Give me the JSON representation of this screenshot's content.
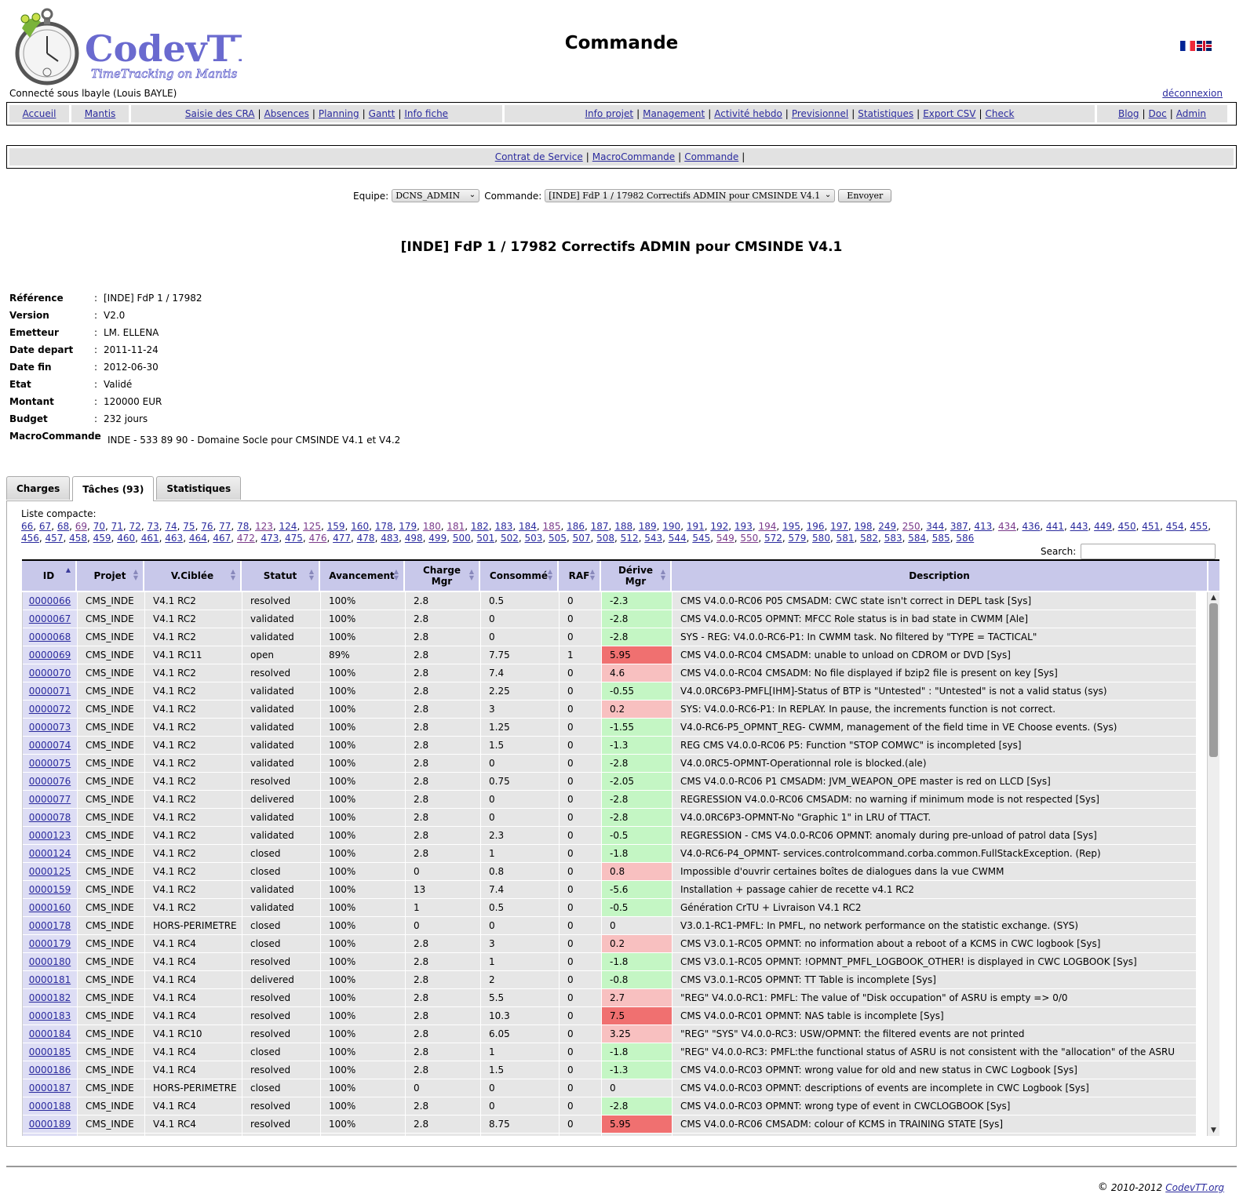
{
  "header": {
    "logo_text": "CodevTT",
    "logo_subtitle": "TimeTracking on Mantis",
    "page_title": "Commande",
    "user_line": "Connecté sous lbayle (Louis BAYLE)",
    "logout": "déconnexion"
  },
  "menu": {
    "home": "Accueil",
    "mantis": "Mantis",
    "group1": [
      "Saisie des CRA",
      "Absences",
      "Planning",
      "Gantt",
      "Info fiche"
    ],
    "group2": [
      "Info projet",
      "Management",
      "Activité hebdo",
      "Previsionnel",
      "Statistiques",
      "Export CSV",
      "Check"
    ],
    "group3": [
      "Blog",
      "Doc",
      "Admin"
    ]
  },
  "submenu": [
    "Contrat de Service",
    "MacroCommande",
    "Commande"
  ],
  "selector": {
    "team_label": "Equipe:",
    "team_value": "DCNS_ADMIN",
    "command_label": "Commande:",
    "command_value": "[INDE] FdP 1 / 17982 Correctifs ADMIN pour CMSINDE V4.1",
    "submit": "Envoyer"
  },
  "command_title": "[INDE] FdP 1 / 17982 Correctifs ADMIN pour CMSINDE V4.1",
  "info": {
    "reference_label": "Référence",
    "reference": "[INDE] FdP 1 / 17982",
    "version_label": "Version",
    "version": "V2.0",
    "emitter_label": "Emetteur",
    "emitter": "LM. ELLENA",
    "start_label": "Date depart",
    "start": "2011-11-24",
    "end_label": "Date fin",
    "end": "2012-06-30",
    "state_label": "Etat",
    "state": "Validé",
    "amount_label": "Montant",
    "amount": "120000 EUR",
    "budget_label": "Budget",
    "budget": "232 jours",
    "macro_label": "MacroCommande",
    "macro": "INDE - 533 89 90 - Domaine Socle pour CMSINDE V4.1 et V4.2"
  },
  "tabs": [
    "Charges",
    "Tâches (93)",
    "Statistiques"
  ],
  "compact": {
    "label": "Liste compacte:",
    "ids": [
      "66",
      "67",
      "68",
      "69",
      "70",
      "71",
      "72",
      "73",
      "74",
      "75",
      "76",
      "77",
      "78",
      "123",
      "124",
      "125",
      "159",
      "160",
      "178",
      "179",
      "180",
      "181",
      "182",
      "183",
      "184",
      "185",
      "186",
      "187",
      "188",
      "189",
      "190",
      "191",
      "192",
      "193",
      "194",
      "195",
      "196",
      "197",
      "198",
      "249",
      "250",
      "344",
      "387",
      "413",
      "434",
      "436",
      "441",
      "443",
      "449",
      "450",
      "451",
      "454",
      "455",
      "456",
      "457",
      "458",
      "459",
      "460",
      "461",
      "463",
      "464",
      "467",
      "472",
      "473",
      "475",
      "476",
      "477",
      "478",
      "483",
      "498",
      "499",
      "500",
      "501",
      "502",
      "503",
      "505",
      "507",
      "508",
      "512",
      "543",
      "544",
      "545",
      "549",
      "550",
      "572",
      "579",
      "580",
      "581",
      "582",
      "583",
      "584",
      "585",
      "586"
    ],
    "visited": [
      "69",
      "123",
      "125",
      "180",
      "181",
      "185",
      "194",
      "250",
      "434",
      "472",
      "476",
      "549",
      "550"
    ]
  },
  "search_label": "Search:",
  "table": {
    "headers": [
      "ID",
      "Projet",
      "V.Ciblée",
      "Statut",
      "Avancement",
      "Charge Mgr",
      "Consommé",
      "RAF",
      "Dérive Mgr",
      "Description"
    ],
    "rows": [
      [
        "0000066",
        "CMS_INDE",
        "V4.1 RC2",
        "resolved",
        "100%",
        "2.8",
        "0.5",
        "0",
        "-2.3",
        "CMS V4.0.0-RC06 P05 CMSADM: CWC state isn't correct in DEPL task [Sys]"
      ],
      [
        "0000067",
        "CMS_INDE",
        "V4.1 RC2",
        "validated",
        "100%",
        "2.8",
        "0",
        "0",
        "-2.8",
        "CMS V4.0.0-RC05 OPMNT: MFCC Role status is in bad state in CWMM [Ale]"
      ],
      [
        "0000068",
        "CMS_INDE",
        "V4.1 RC2",
        "validated",
        "100%",
        "2.8",
        "0",
        "0",
        "-2.8",
        "SYS - REG: V4.0.0-RC6-P1: In CWMM task. No filtered by \"TYPE = TACTICAL\""
      ],
      [
        "0000069",
        "CMS_INDE",
        "V4.1 RC11",
        "open",
        "89%",
        "2.8",
        "7.75",
        "1",
        "5.95",
        "CMS V4.0.0-RC04 CMSADM: unable to unload on CDROM or DVD [Sys]"
      ],
      [
        "0000070",
        "CMS_INDE",
        "V4.1 RC2",
        "resolved",
        "100%",
        "2.8",
        "7.4",
        "0",
        "4.6",
        "CMS V4.0.0-RC04 CMSADM: No file displayed if bzip2 file is present on key [Sys]"
      ],
      [
        "0000071",
        "CMS_INDE",
        "V4.1 RC2",
        "validated",
        "100%",
        "2.8",
        "2.25",
        "0",
        "-0.55",
        "V4.0.0RC6P3-PMFL[IHM]-Status of BTP is \"Untested\" : \"Untested\" is not a valid status (sys)"
      ],
      [
        "0000072",
        "CMS_INDE",
        "V4.1 RC2",
        "validated",
        "100%",
        "2.8",
        "3",
        "0",
        "0.2",
        "SYS: V4.0.0-RC6-P1: In REPLAY. In pause, the increments function is not correct."
      ],
      [
        "0000073",
        "CMS_INDE",
        "V4.1 RC2",
        "validated",
        "100%",
        "2.8",
        "1.25",
        "0",
        "-1.55",
        "V4.0-RC6-P5_OPMNT_REG- CWMM, management of the field time in VE Choose events. (Sys)"
      ],
      [
        "0000074",
        "CMS_INDE",
        "V4.1 RC2",
        "validated",
        "100%",
        "2.8",
        "1.5",
        "0",
        "-1.3",
        "REG CMS V4.0.0-RC06 P5: Function \"STOP COMWC\" is incompleted [sys]"
      ],
      [
        "0000075",
        "CMS_INDE",
        "V4.1 RC2",
        "validated",
        "100%",
        "2.8",
        "0",
        "0",
        "-2.8",
        "V4.0.0RC5-OPMNT-Operationnal role is blocked.(ale)"
      ],
      [
        "0000076",
        "CMS_INDE",
        "V4.1 RC2",
        "resolved",
        "100%",
        "2.8",
        "0.75",
        "0",
        "-2.05",
        "CMS V4.0.0-RC06 P1 CMSADM: JVM_WEAPON_OPE master is red on LLCD [Sys]"
      ],
      [
        "0000077",
        "CMS_INDE",
        "V4.1 RC2",
        "delivered",
        "100%",
        "2.8",
        "0",
        "0",
        "-2.8",
        "REGRESSION V4.0.0-RC06 CMSADM: no warning if minimum mode is not respected [Sys]"
      ],
      [
        "0000078",
        "CMS_INDE",
        "V4.1 RC2",
        "validated",
        "100%",
        "2.8",
        "0",
        "0",
        "-2.8",
        "V4.0.0RC6P3-OPMNT-No \"Graphic 1\" in LRU of TTACT."
      ],
      [
        "0000123",
        "CMS_INDE",
        "V4.1 RC2",
        "validated",
        "100%",
        "2.8",
        "2.3",
        "0",
        "-0.5",
        "REGRESSION - CMS V4.0.0-RC06 OPMNT: anomaly during pre-unload of patrol data [Sys]"
      ],
      [
        "0000124",
        "CMS_INDE",
        "V4.1 RC2",
        "closed",
        "100%",
        "2.8",
        "1",
        "0",
        "-1.8",
        "V4.0-RC6-P4_OPMNT- services.controlcommand.corba.common.FullStackException. (Rep)"
      ],
      [
        "0000125",
        "CMS_INDE",
        "V4.1 RC2",
        "closed",
        "100%",
        "0",
        "0.8",
        "0",
        "0.8",
        "Impossible d'ouvrir certaines boîtes de dialogues dans la vue CWMM"
      ],
      [
        "0000159",
        "CMS_INDE",
        "V4.1 RC2",
        "validated",
        "100%",
        "13",
        "7.4",
        "0",
        "-5.6",
        "Installation + passage cahier de recette v4.1 RC2"
      ],
      [
        "0000160",
        "CMS_INDE",
        "V4.1 RC2",
        "validated",
        "100%",
        "1",
        "0.5",
        "0",
        "-0.5",
        "Génération CrTU + Livraison V4.1 RC2"
      ],
      [
        "0000178",
        "CMS_INDE",
        "HORS-PERIMETRE",
        "closed",
        "100%",
        "0",
        "0",
        "0",
        "0",
        "V3.0.1-RC1-PMFL: In PMFL, no network performance on the statistic exchange. (SYS)"
      ],
      [
        "0000179",
        "CMS_INDE",
        "V4.1 RC4",
        "closed",
        "100%",
        "2.8",
        "3",
        "0",
        "0.2",
        "CMS V3.0.1-RC05 OPMNT: no information about a reboot of a KCMS in CWC logbook [Sys]"
      ],
      [
        "0000180",
        "CMS_INDE",
        "V4.1 RC4",
        "resolved",
        "100%",
        "2.8",
        "1",
        "0",
        "-1.8",
        "CMS V3.0.1-RC05 OPMNT: !OPMNT_PMFL_LOGBOOK_OTHER! is displayed in CWC LOGBOOK [Sys]"
      ],
      [
        "0000181",
        "CMS_INDE",
        "V4.1 RC4",
        "delivered",
        "100%",
        "2.8",
        "2",
        "0",
        "-0.8",
        "CMS V3.0.1-RC05 OPMNT: TT Table is incomplete [Sys]"
      ],
      [
        "0000182",
        "CMS_INDE",
        "V4.1 RC4",
        "resolved",
        "100%",
        "2.8",
        "5.5",
        "0",
        "2.7",
        "\"REG\" V4.0.0-RC1: PMFL: The value of \"Disk occupation\" of ASRU is empty => 0/0"
      ],
      [
        "0000183",
        "CMS_INDE",
        "V4.1 RC4",
        "resolved",
        "100%",
        "2.8",
        "10.3",
        "0",
        "7.5",
        "CMS V4.0.0-RC01 OPMNT: NAS table is incomplete [Sys]"
      ],
      [
        "0000184",
        "CMS_INDE",
        "V4.1 RC10",
        "resolved",
        "100%",
        "2.8",
        "6.05",
        "0",
        "3.25",
        "\"REG\" \"SYS\" V4.0.0-RC3: USW/OPMNT: the filtered events are not printed"
      ],
      [
        "0000185",
        "CMS_INDE",
        "V4.1 RC4",
        "closed",
        "100%",
        "2.8",
        "1",
        "0",
        "-1.8",
        "\"REG\" V4.0.0-RC3: PMFL:the functional status of ASRU is not consistent with the \"allocation\" of the ASRU"
      ],
      [
        "0000186",
        "CMS_INDE",
        "V4.1 RC4",
        "resolved",
        "100%",
        "2.8",
        "1.5",
        "0",
        "-1.3",
        "CMS V4.0.0-RC03 OPMNT: wrong value for old and new status in CWC Logbook [Sys]"
      ],
      [
        "0000187",
        "CMS_INDE",
        "HORS-PERIMETRE",
        "closed",
        "100%",
        "0",
        "0",
        "0",
        "0",
        "CMS V4.0.0-RC03 OPMNT: descriptions of events are incomplete in CWC Logbook [Sys]"
      ],
      [
        "0000188",
        "CMS_INDE",
        "V4.1 RC4",
        "resolved",
        "100%",
        "2.8",
        "0",
        "0",
        "-2.8",
        "CMS V4.0.0-RC03 OPMNT: wrong type of event in CWCLOGBOOK [Sys]"
      ],
      [
        "0000189",
        "CMS_INDE",
        "V4.1 RC4",
        "resolved",
        "100%",
        "2.8",
        "8.75",
        "0",
        "5.95",
        "CMS V4.0.0-RC06 CMSADM: colour of KCMS in TRAINING STATE [Sys]"
      ],
      [
        "",
        "",
        "",
        "",
        "",
        "",
        "",
        "",
        "",
        ""
      ]
    ]
  },
  "footer": {
    "copyright_symbol": "©",
    "years": "2010-2012",
    "site": "CodevTT.org"
  },
  "colors": {
    "header_bg": "#c8c8ea",
    "negative_drift": "#c4f6c4",
    "positive_drift": "#f8c0c0",
    "high_drift": "#f07070",
    "link": "#2b2b9e"
  }
}
